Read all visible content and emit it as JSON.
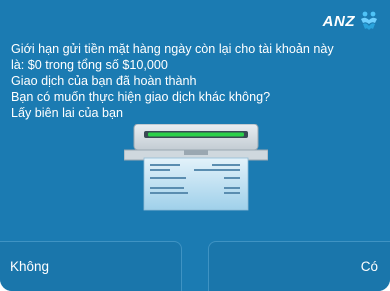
{
  "brand": {
    "name": "ANZ"
  },
  "message": {
    "lines": [
      "Giới hạn gửi tiền mặt hàng ngày còn lại cho tài khoản này",
      "là: $0 trong tổng số $10,000",
      "Giao dịch của bạn đã hoàn thành",
      "Bạn có muốn thực hiện giao dịch khác không?",
      "Lấy biên lai của bạn"
    ]
  },
  "illustration": {
    "icon": "receipt-printer-icon"
  },
  "buttons": {
    "no_label": "Không",
    "yes_label": "Có"
  },
  "colors": {
    "background": "#1b7bb2",
    "button_border": "#3f93c3",
    "slot_green": "#2bd14a"
  }
}
